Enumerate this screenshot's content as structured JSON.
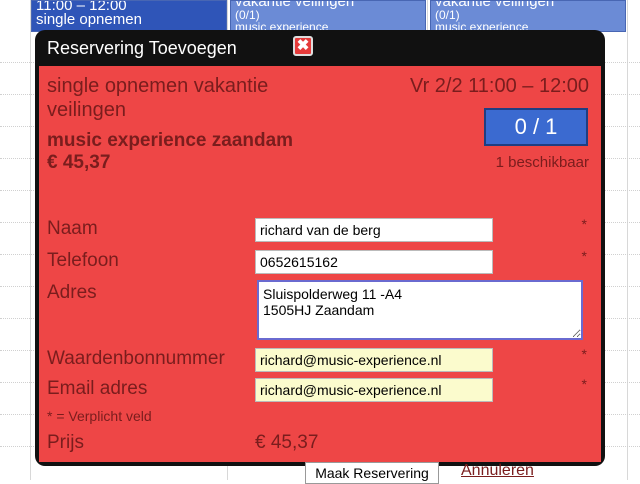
{
  "calendar": {
    "events": [
      {
        "time": "11:00 – 12:00",
        "title": "single opnemen"
      },
      {
        "title": "vakantie veilingen",
        "count": "(0/1)",
        "sub": "music experience"
      },
      {
        "title": "vakantie veilingen",
        "count": "(0/1)",
        "sub": "music experience"
      }
    ]
  },
  "dialog": {
    "title": "Reservering Toevoegen",
    "close_symbol": "✖",
    "event_title": "single opnemen vakantie veilingen",
    "event_date": "Vr 2/2  11:00 – 12:00",
    "location": "music experience zaandam",
    "price": "€ 45,37",
    "counter": "0 / 1",
    "availability": "1 beschikbaar",
    "fields": {
      "naam": {
        "label": "Naam",
        "value": "richard van de berg",
        "required": "*"
      },
      "telefoon": {
        "label": "Telefoon",
        "value": "0652615162",
        "required": "*"
      },
      "adres": {
        "label": "Adres",
        "value": "Sluispolderweg 11 -A4\n1505HJ Zaandam"
      },
      "waardenbon": {
        "label": "Waardenbonnummer",
        "value": "richard@music-experience.nl",
        "required": "*"
      },
      "email": {
        "label": "Email adres",
        "value": "richard@music-experience.nl",
        "required": "*"
      }
    },
    "required_note": "* = Verplicht veld",
    "price_label": "Prijs",
    "price_value": "€ 45,37",
    "submit_label": "Maak Reservering",
    "cancel_label": "Annuleren"
  },
  "colors": {
    "panel": "#ee4646",
    "dialog_frame": "#111111",
    "counter": "#3b6ad0",
    "event": "#6b8bd6"
  }
}
